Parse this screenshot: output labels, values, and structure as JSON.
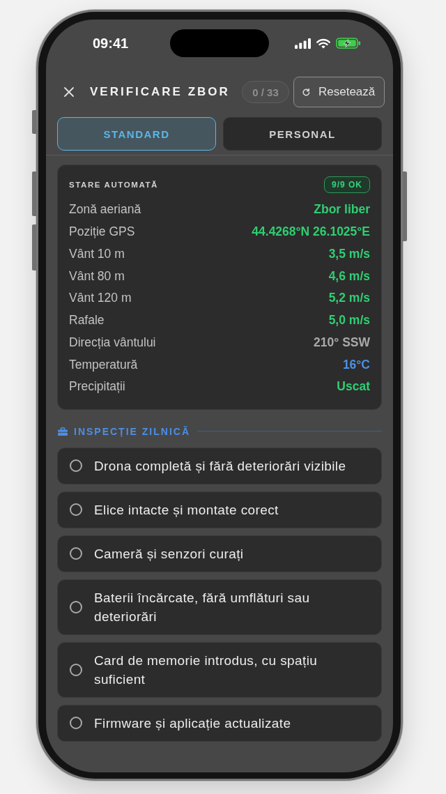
{
  "status_bar": {
    "time": "09:41"
  },
  "header": {
    "title": "VERIFICARE ZBOR",
    "counter": "0 / 33",
    "reset_label": "Resetează"
  },
  "tabs": [
    {
      "label": "STANDARD",
      "selected": true
    },
    {
      "label": "PERSONAL",
      "selected": false
    }
  ],
  "status_card": {
    "title": "STARE AUTOMATĂ",
    "badge": "9/9 OK",
    "rows": [
      {
        "label": "Zonă aeriană",
        "value": "Zbor liber",
        "color": "#2fce72"
      },
      {
        "label": "Poziție GPS",
        "value": "44.4268°N 26.1025°E",
        "color": "#2fce72"
      },
      {
        "label": "Vânt 10 m",
        "value": "3,5 m/s",
        "color": "#2fce72"
      },
      {
        "label": "Vânt 80 m",
        "value": "4,6 m/s",
        "color": "#2fce72"
      },
      {
        "label": "Vânt 120 m",
        "value": "5,2 m/s",
        "color": "#2fce72"
      },
      {
        "label": "Rafale",
        "value": "5,0 m/s",
        "color": "#2fce72"
      },
      {
        "label": "Direcția vântului",
        "value": "210° SSW",
        "color": "#a9a9a9"
      },
      {
        "label": "Temperatură",
        "value": "16°C",
        "color": "#4b8fe6"
      },
      {
        "label": "Precipitații",
        "value": "Uscat",
        "color": "#2fce72"
      }
    ]
  },
  "inspection": {
    "title": "INSPECȚIE ZILNICĂ",
    "items": [
      {
        "label": "Drona completă și fără deteriorări vizibile",
        "checked": false
      },
      {
        "label": "Elice intacte și montate corect",
        "checked": false
      },
      {
        "label": "Cameră și senzori curați",
        "checked": false
      },
      {
        "label": "Baterii încărcate, fără umflături sau deteriorări",
        "checked": false
      },
      {
        "label": "Card de memorie introdus, cu spațiu suficient",
        "checked": false
      },
      {
        "label": "Firmware și aplicație actualizate",
        "checked": false
      }
    ]
  }
}
